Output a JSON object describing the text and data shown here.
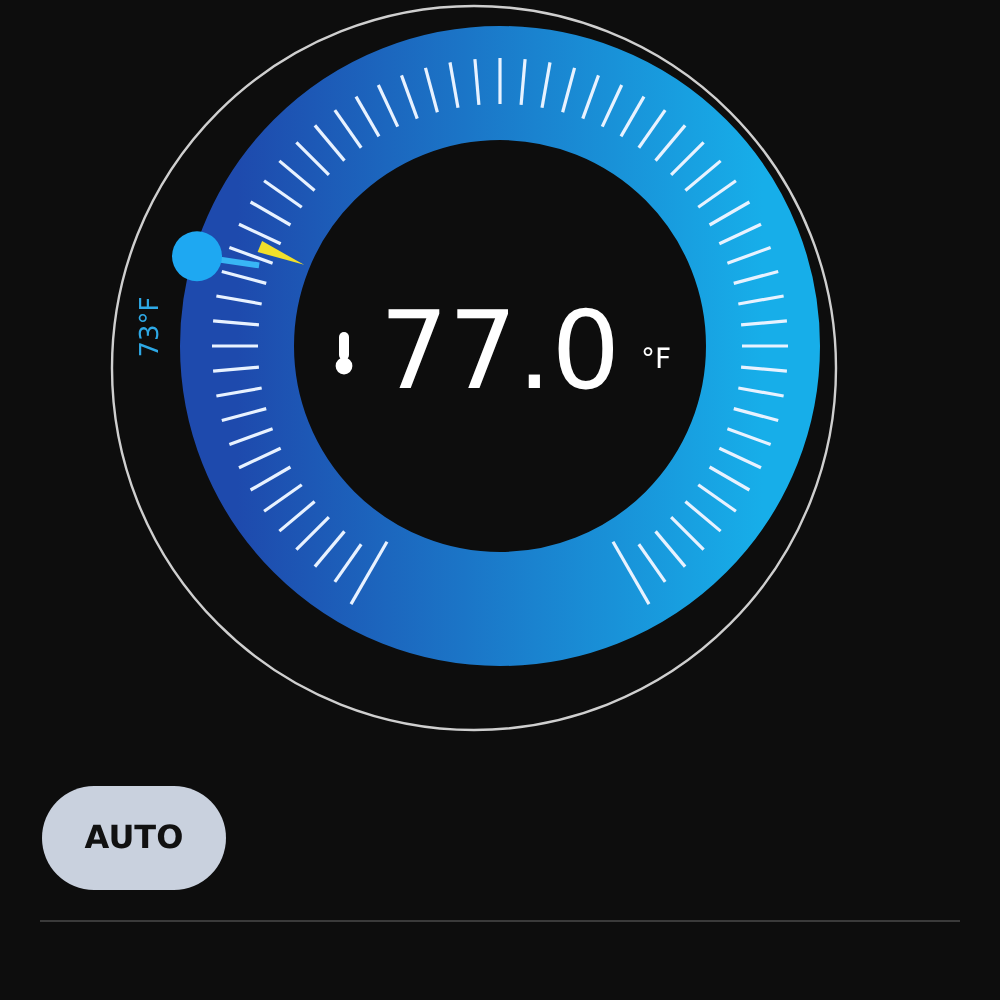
{
  "dial": {
    "setpoint": {
      "label": "73°F"
    },
    "current": {
      "value": "77.0",
      "unit": "°F"
    }
  },
  "mode_button": {
    "label": "AUTO"
  }
}
